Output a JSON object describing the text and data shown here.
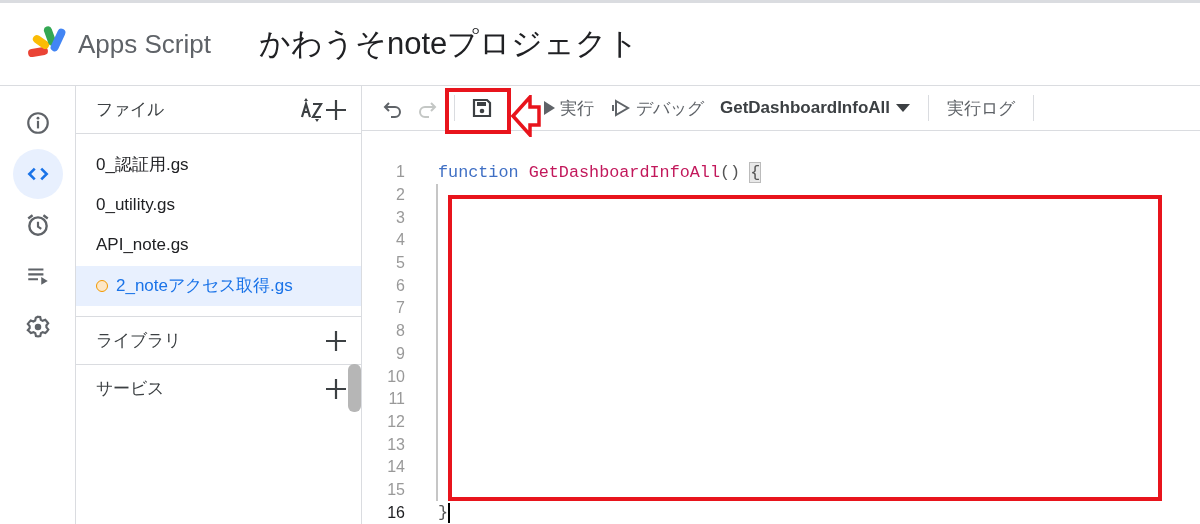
{
  "app": {
    "name": "Apps Script",
    "project_title": "かわうそnoteプロジェクト"
  },
  "rail": [
    {
      "kind": "info",
      "selected": false
    },
    {
      "kind": "code",
      "selected": true
    },
    {
      "kind": "clock",
      "selected": false
    },
    {
      "kind": "executions",
      "selected": false
    },
    {
      "kind": "settings",
      "selected": false
    }
  ],
  "files": {
    "title": "ファイル",
    "items": [
      {
        "name": "0_認証用.gs",
        "selected": false,
        "unsaved": false
      },
      {
        "name": "0_utility.gs",
        "selected": false,
        "unsaved": false
      },
      {
        "name": "API_note.gs",
        "selected": false,
        "unsaved": false
      },
      {
        "name": "2_noteアクセス取得.gs",
        "selected": true,
        "unsaved": true
      }
    ]
  },
  "sections": [
    {
      "title": "ライブラリ"
    },
    {
      "title": "サービス"
    }
  ],
  "toolbar": {
    "redo_disabled": true,
    "run": "実行",
    "debug": "デバッグ",
    "function": "GetDashboardInfoAll",
    "log": "実行ログ"
  },
  "editor": {
    "lines": [
      {
        "number": "1",
        "current": false,
        "tokens": [
          {
            "kind": "keyword",
            "text": "function"
          },
          {
            "kind": "name",
            "text": "GetDashboardInfoAll"
          },
          {
            "kind": "punct",
            "text": "()"
          },
          {
            "kind": "match",
            "text": "{"
          }
        ]
      },
      {
        "number": "2",
        "current": false
      },
      {
        "number": "3",
        "current": false
      },
      {
        "number": "4",
        "current": false
      },
      {
        "number": "5",
        "current": false
      },
      {
        "number": "6",
        "current": false
      },
      {
        "number": "7",
        "current": false
      },
      {
        "number": "8",
        "current": false
      },
      {
        "number": "9",
        "current": false
      },
      {
        "number": "10",
        "current": false
      },
      {
        "number": "11",
        "current": false
      },
      {
        "number": "12",
        "current": false
      },
      {
        "number": "13",
        "current": false
      },
      {
        "number": "14",
        "current": false
      },
      {
        "number": "15",
        "current": false
      },
      {
        "number": "16",
        "current": true,
        "tokens": [
          {
            "kind": "punct",
            "text": "}"
          }
        ]
      }
    ]
  }
}
